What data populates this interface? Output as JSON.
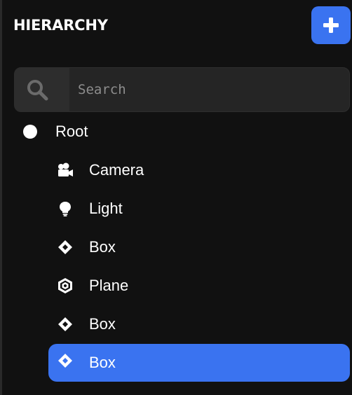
{
  "panel": {
    "title": "HIERARCHY",
    "add_button_icon": "plus-icon"
  },
  "search": {
    "placeholder": "Search",
    "value": "",
    "icon": "search-icon"
  },
  "tree": {
    "root": {
      "label": "Root",
      "icon": "circle-icon"
    },
    "children": [
      {
        "label": "Camera",
        "icon": "camera-icon",
        "selected": false
      },
      {
        "label": "Light",
        "icon": "lightbulb-icon",
        "selected": false
      },
      {
        "label": "Box",
        "icon": "diamond-icon",
        "selected": false
      },
      {
        "label": "Plane",
        "icon": "hexagon-icon",
        "selected": false
      },
      {
        "label": "Box",
        "icon": "diamond-icon",
        "selected": false
      },
      {
        "label": "Box",
        "icon": "diamond-icon",
        "selected": true
      }
    ]
  },
  "colors": {
    "background": "#111111",
    "accent": "#3a73f0",
    "search_bg": "#252525",
    "text": "#ffffff"
  }
}
